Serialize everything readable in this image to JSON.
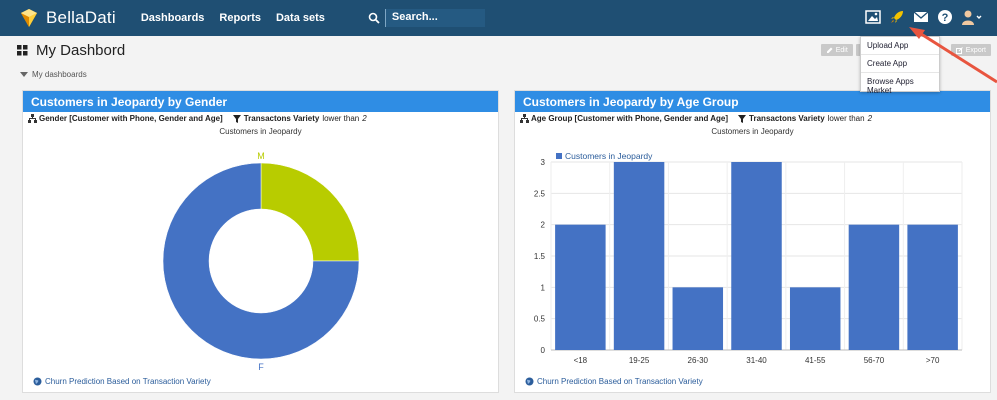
{
  "app": {
    "name": "BellaDati",
    "nav": [
      "Dashboards",
      "Reports",
      "Data sets"
    ],
    "search_placeholder": "Search..."
  },
  "page": {
    "title": "My Dashbord",
    "breadcrumb": "My dashboards",
    "buttons": [
      "Edit",
      "Export"
    ]
  },
  "dropdown": {
    "items": [
      "Upload App",
      "Create App",
      "Browse Apps Market"
    ]
  },
  "panels": [
    {
      "title": "Customers in Jeopardy by Gender",
      "filter_attribute": "Gender [Customer with Phone, Gender and Age]",
      "filter_indicator": "Transactons Variety",
      "filter_condition": "lower than",
      "filter_value": "2",
      "chart_title": "Customers in Jeopardy",
      "footer": "Churn Prediction Based on Transaction Variety"
    },
    {
      "title": "Customers in Jeopardy by Age Group",
      "filter_attribute": "Age Group [Customer with Phone, Gender and Age]",
      "filter_indicator": "Transactons Variety",
      "filter_condition": "lower than",
      "filter_value": "2",
      "chart_title": "Customers in Jeopardy",
      "footer": "Churn Prediction Based on Transaction Variety"
    }
  ],
  "colors": {
    "nav_bg": "#1f4f73",
    "panel_header": "#2f8de4",
    "bar_blue": "#4472c4",
    "slice_green": "#b8cc00"
  },
  "chart_data": [
    {
      "type": "pie",
      "title": "Customers in Jeopardy",
      "categories": [
        "M",
        "F"
      ],
      "values": [
        1,
        3
      ],
      "colors": [
        "#b8cc00",
        "#4472c4"
      ]
    },
    {
      "type": "bar",
      "title": "Customers in Jeopardy",
      "categories": [
        "<18",
        "19-25",
        "26-30",
        "31-40",
        "41-55",
        "56-70",
        ">70"
      ],
      "series": [
        {
          "name": "Customers in Jeopardy",
          "values": [
            2,
            3,
            1,
            3,
            1,
            2,
            2
          ]
        }
      ],
      "ylim": [
        0,
        3
      ],
      "yticks": [
        "0",
        "0.5",
        "1",
        "1.5",
        "2",
        "2.5",
        "3"
      ],
      "legend": "top-left",
      "grid": true
    }
  ]
}
